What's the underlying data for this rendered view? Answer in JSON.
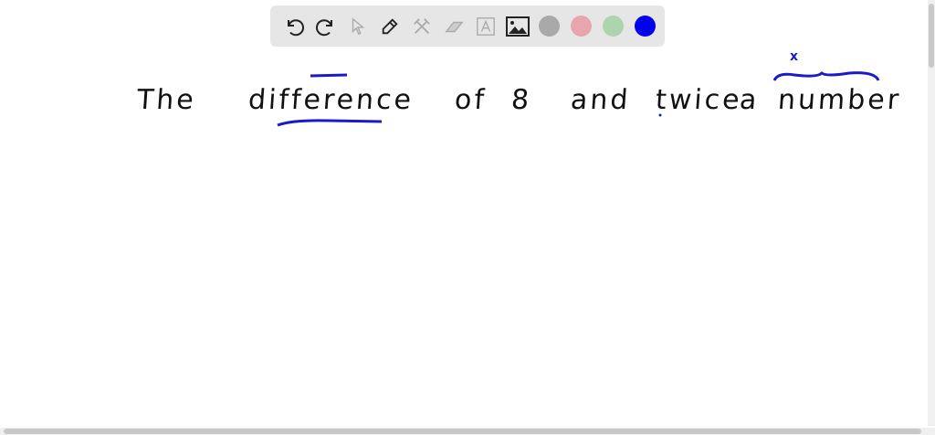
{
  "toolbar": {
    "tools": [
      "undo-icon",
      "redo-icon",
      "pointer-icon",
      "pen-icon",
      "tools-icon",
      "eraser-icon",
      "text-icon",
      "image-icon"
    ],
    "colors": [
      "#a9a9a9",
      "#e8a5ad",
      "#add5ad",
      "#0000ee"
    ]
  },
  "canvas": {
    "words": [
      "The",
      "difference",
      "of",
      "8",
      "and",
      "twice",
      "a",
      "number"
    ],
    "annotation": "x",
    "ink_color": "#111111",
    "accent_color": "#1a1acc"
  }
}
